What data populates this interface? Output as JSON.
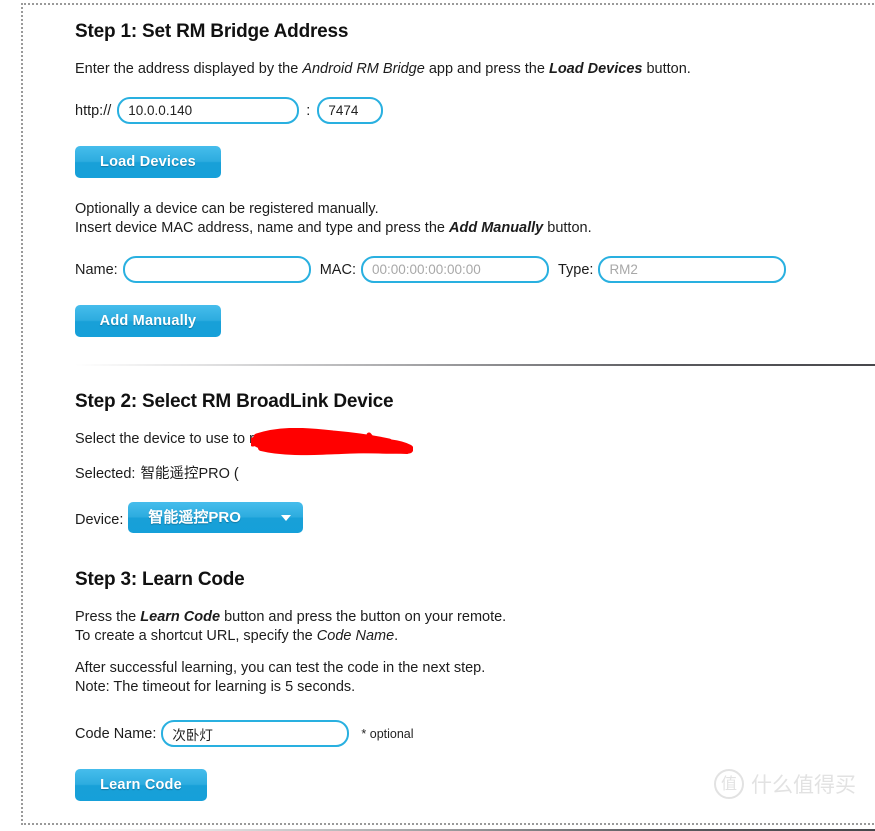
{
  "step1": {
    "title": "Step 1: Set RM Bridge Address",
    "intro_a": "Enter the address displayed by the ",
    "intro_em": "Android RM Bridge",
    "intro_b": " app and press the ",
    "intro_strong": "Load Devices",
    "intro_c": " button.",
    "scheme_label": "http://",
    "host_value": "10.0.0.140",
    "colon": ":",
    "port_value": "7474",
    "load_devices_label": "Load Devices",
    "manual_line1": "Optionally a device can be registered manually.",
    "manual_line2_a": "Insert device MAC address, name and type and press the ",
    "manual_line2_strong": "Add Manually",
    "manual_line2_b": " button.",
    "name_label": "Name:",
    "name_value": "",
    "name_placeholder": "",
    "mac_label": "MAC:",
    "mac_value": "",
    "mac_placeholder": "00:00:00:00:00:00",
    "type_label": "Type:",
    "type_value": "",
    "type_placeholder": "RM2",
    "add_manually_label": "Add Manually"
  },
  "step2": {
    "title": "Step 2: Select RM BroadLink Device",
    "intro": "Select the device to use to record codes.",
    "selected_label": "Selected:",
    "selected_value": "智能遥控PRO (",
    "device_label": "Device:",
    "device_selected_option": "智能遥控PRO",
    "device_options": [
      "智能遥控PRO"
    ],
    "redaction_color": "#ff0000"
  },
  "step3": {
    "title": "Step 3: Learn Code",
    "line1_a": "Press the ",
    "line1_strong": "Learn Code",
    "line1_b": " button and press the button on your remote.",
    "line2_a": "To create a shortcut URL, specify the ",
    "line2_em": "Code Name",
    "line2_b": ".",
    "line3": "After successful learning, you can test the code in the next step.",
    "line4": "Note: The timeout for learning is 5 seconds.",
    "code_name_label": "Code Name:",
    "code_name_value": "次卧灯",
    "code_name_placeholder": "",
    "optional_note": "* optional",
    "learn_code_label": "Learn Code"
  },
  "watermark": {
    "logo_glyph": "值",
    "text": "什么值得买"
  },
  "theme": {
    "accent_blue": "#29b0e0",
    "button_blue_top": "#46bdec",
    "button_blue_bottom": "#16a0d9",
    "text_color": "#1c1c1c"
  }
}
